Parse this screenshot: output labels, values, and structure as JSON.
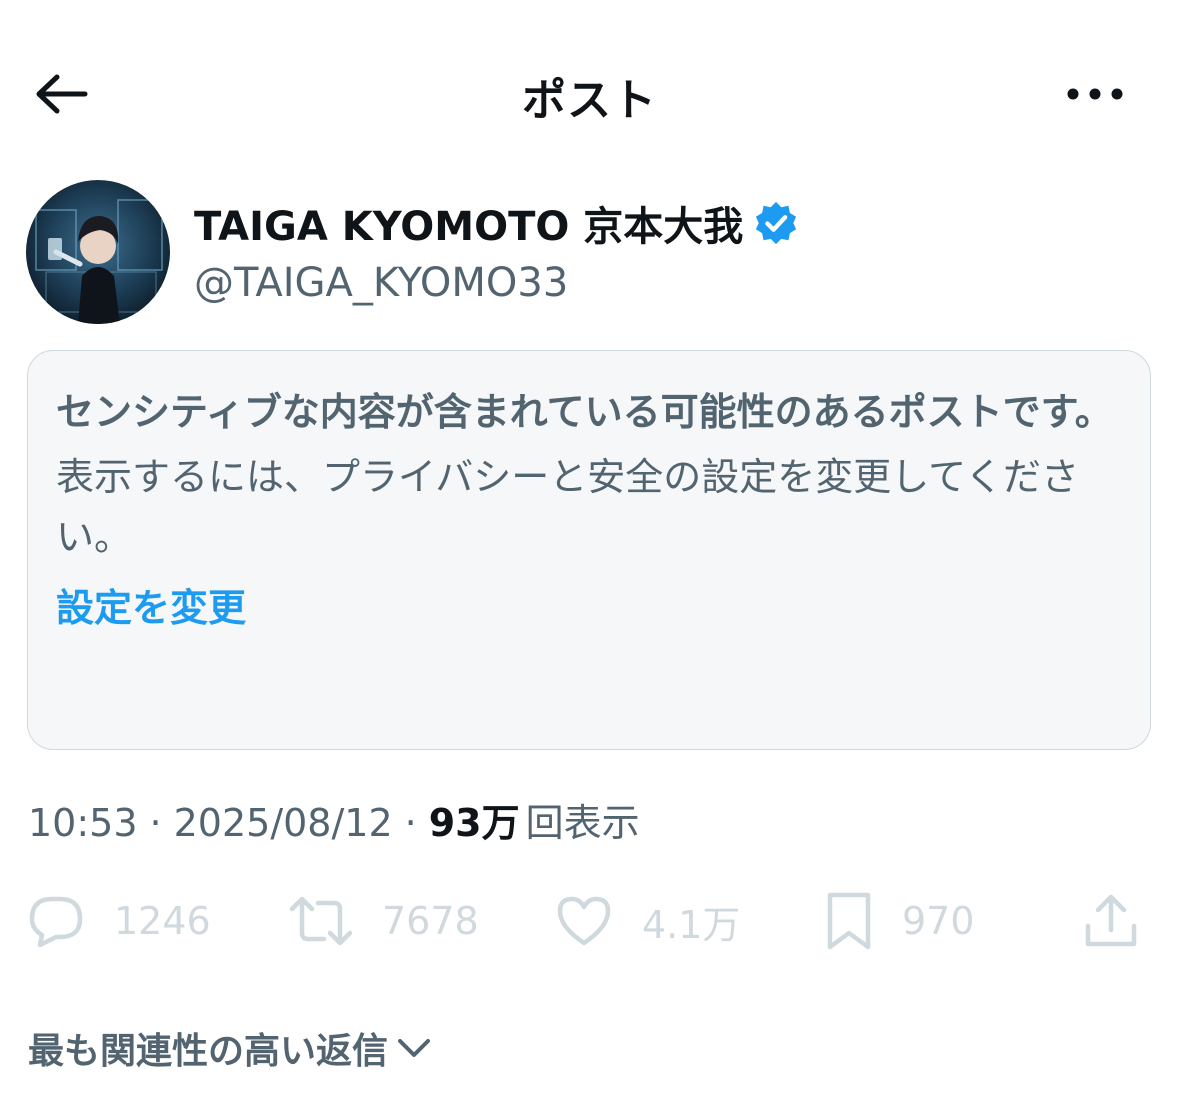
{
  "header": {
    "title": "ポスト",
    "back_icon": "arrow-left-icon",
    "more_icon": "more-horizontal-icon"
  },
  "author": {
    "display_name": "TAIGA KYOMOTO 京本大我",
    "handle": "@TAIGA_KYOMO33",
    "verified": true,
    "verified_color": "#1d9bf0"
  },
  "sensitive_notice": {
    "title": "センシティブな内容が含まれている可能性のあるポストです。",
    "body": "表示するには、プライバシーと安全の設定を変更してください。",
    "link": "設定を変更"
  },
  "meta": {
    "time": "10:53",
    "date": "2025/08/12",
    "views_count": "93万",
    "views_label": "回表示"
  },
  "actions": {
    "replies": "1246",
    "reposts": "7678",
    "likes": "4.1万",
    "bookmarks": "970"
  },
  "replies_sort": {
    "label": "最も関連性の高い返信"
  },
  "colors": {
    "text_primary": "#0f1419",
    "text_secondary": "#536471",
    "accent": "#1d9bf0",
    "muted": "#cfd9de"
  }
}
